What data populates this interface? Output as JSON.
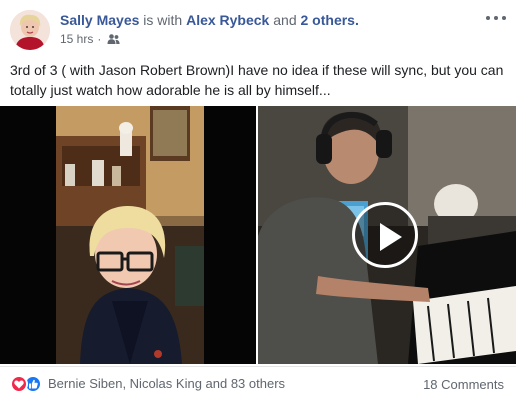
{
  "post": {
    "author": "Sally Mayes",
    "with_text": "is with",
    "tagged": "Alex Rybeck",
    "and_text": "and",
    "others_link": "2 others.",
    "time": "15 hrs",
    "dot": "·",
    "body": "3rd of 3 ( with Jason Robert Brown)I have no idea if these will sync, but you can totally just watch how adorable he is all by himself..."
  },
  "reactions": {
    "names": "Bernie Siben, Nicolas King and 83 others",
    "love_color": "#f0284a",
    "like_color": "#1877f2"
  },
  "comments": {
    "label": "18 Comments"
  },
  "icons": {
    "audience": "friends-icon",
    "more": "more-options-icon",
    "play": "play-icon"
  },
  "colors": {
    "link": "#385898",
    "muted": "#616770"
  }
}
